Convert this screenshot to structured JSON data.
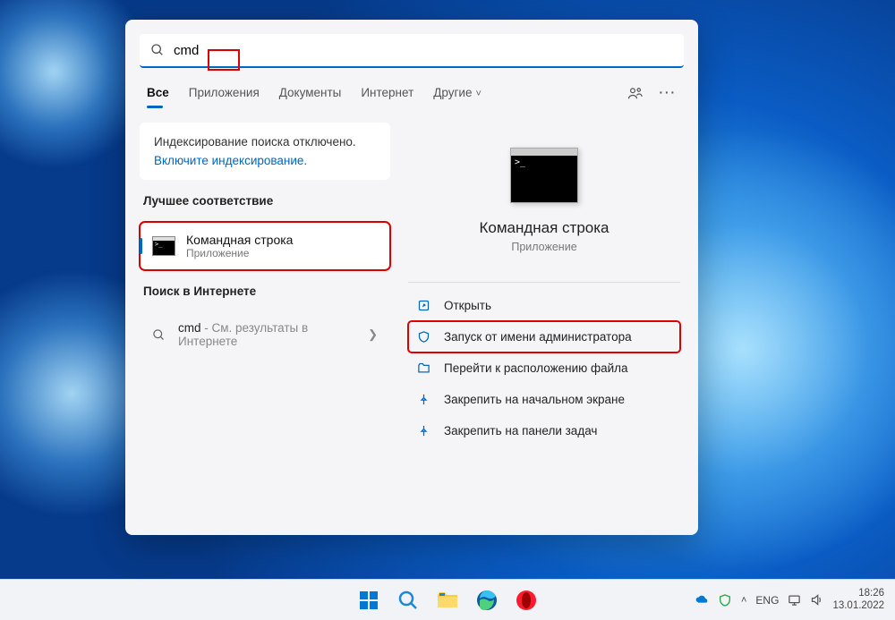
{
  "search": {
    "query": "cmd"
  },
  "tabs": {
    "all": "Все",
    "apps": "Приложения",
    "docs": "Документы",
    "web": "Интернет",
    "more": "Другие"
  },
  "index_card": {
    "message": "Индексирование поиска отключено.",
    "link": "Включите индексирование."
  },
  "sections": {
    "best_match": "Лучшее соответствие",
    "web_search": "Поиск в Интернете"
  },
  "best_result": {
    "title": "Командная строка",
    "subtitle": "Приложение"
  },
  "web_result": {
    "term": "cmd",
    "suffix": " - См. результаты в Интернете"
  },
  "preview": {
    "title": "Командная строка",
    "subtitle": "Приложение"
  },
  "actions": {
    "open": "Открыть",
    "run_admin": "Запуск от имени администратора",
    "file_location": "Перейти к расположению файла",
    "pin_start": "Закрепить на начальном экране",
    "pin_taskbar": "Закрепить на панели задач"
  },
  "systray": {
    "lang": "ENG",
    "time": "18:26",
    "date": "13.01.2022"
  }
}
